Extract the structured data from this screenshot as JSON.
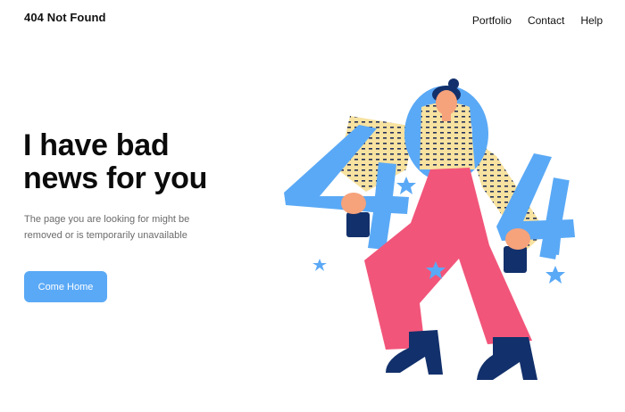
{
  "header": {
    "brand": "404 Not Found",
    "nav": [
      "Portfolio",
      "Contact",
      "Help"
    ]
  },
  "hero": {
    "headline_line1": "I have bad",
    "headline_line2": "news for you",
    "subtext_line1": "The page you are looking for might be",
    "subtext_line2": "removed or is temporarily unavailable",
    "cta_label": "Come Home"
  },
  "colors": {
    "accent": "#5aa9f6",
    "pants": "#f2557a",
    "navy": "#12306b",
    "yellow": "#f7e2a0",
    "text": "#111111"
  },
  "illustration": {
    "icon": "404-character-illustration"
  }
}
